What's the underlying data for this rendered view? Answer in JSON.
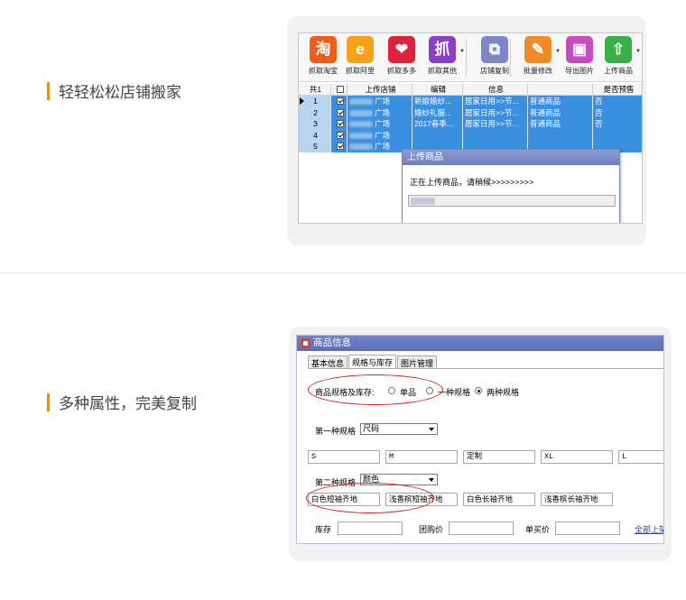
{
  "section1": {
    "feature_text": "轻轻松松店铺搬家",
    "toolbar": [
      {
        "label": "抓取淘宝",
        "icon": "taobao-icon",
        "glyph": "淘",
        "color": "#f25b18"
      },
      {
        "label": "抓取阿里",
        "icon": "alibaba-icon",
        "glyph": "e",
        "color": "#f7a21a"
      },
      {
        "label": "抓取多多",
        "icon": "pinduoduo-icon",
        "glyph": "❤",
        "color": "#e0233c"
      },
      {
        "label": "抓取其他",
        "icon": "grab-other-icon",
        "glyph": "抓",
        "color": "#8a3fc8"
      },
      {
        "label": "店铺复制",
        "icon": "shop-copy-icon",
        "glyph": "⧉",
        "color": "#7f86c7"
      },
      {
        "label": "批量修改",
        "icon": "pencil-icon",
        "glyph": "✎",
        "color": "#f08a24"
      },
      {
        "label": "导出图片",
        "icon": "image-export-icon",
        "glyph": "▣",
        "color": "#c84bc0"
      },
      {
        "label": "上传商品",
        "icon": "upload-icon",
        "glyph": "⇧",
        "color": "#3ab04a"
      }
    ],
    "grid": {
      "headers": [
        "共1",
        "",
        "上传店铺",
        "编辑",
        "信息",
        "",
        "是否预售"
      ],
      "rows": [
        {
          "num": "1",
          "shop": "广场",
          "edit": "新娘婚纱...",
          "info": "居家日用>>节...",
          "type": "普通商品",
          "presale": "否"
        },
        {
          "num": "2",
          "shop": "广场",
          "edit": "婚纱礼服...",
          "info": "居家日用>>节...",
          "type": "普通商品",
          "presale": "否"
        },
        {
          "num": "3",
          "shop": "广场",
          "edit": "2017春季...",
          "info": "居家日用>>节...",
          "type": "普通商品",
          "presale": "否"
        },
        {
          "num": "4",
          "shop": "广场",
          "edit": "",
          "info": "",
          "type": "",
          "presale": ""
        },
        {
          "num": "5",
          "shop": "广场",
          "edit": "",
          "info": "",
          "type": "",
          "presale": ""
        }
      ]
    },
    "dialog": {
      "title": "上传商品",
      "message": "正在上传商品，请稍候>>>>>>>>>",
      "progress": 0.12
    }
  },
  "section2": {
    "feature_text": "多种属性，完美复制",
    "window_title": "商品信息",
    "tabs": [
      "基本信息",
      "规格与库存",
      "图片管理"
    ],
    "spec_label": "商品规格及库存:",
    "radio_options": [
      "单品",
      "一种规格",
      "两种规格"
    ],
    "first_spec_label": "第一种规格",
    "first_spec_value": "尺码",
    "first_spec_values": [
      "S",
      "M",
      "定制",
      "XL",
      "L"
    ],
    "second_spec_label": "第二种规格",
    "second_spec_value": "颜色",
    "second_spec_values": [
      "白色短袖齐地",
      "浅香槟短袖齐地",
      "白色长袖齐地",
      "浅香槟长袖齐地"
    ],
    "stock_label": "库存",
    "group_price_label": "团购价",
    "single_price_label": "单买价",
    "link_label": "全部上架"
  }
}
